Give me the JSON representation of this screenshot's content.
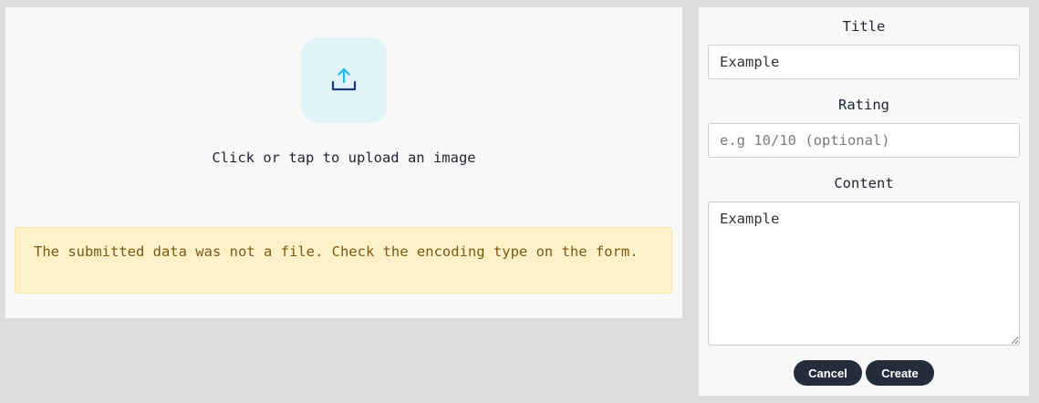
{
  "upload": {
    "icon": "upload-icon",
    "prompt": "Click or tap to upload an image"
  },
  "error": {
    "message": "The submitted data was not a file. Check the encoding type on the form."
  },
  "form": {
    "title_label": "Title",
    "title_value": "Example",
    "rating_label": "Rating",
    "rating_value": "",
    "rating_placeholder": "e.g 10/10 (optional)",
    "content_label": "Content",
    "content_value": "Example",
    "cancel_label": "Cancel",
    "create_label": "Create"
  },
  "colors": {
    "background": "#dcdcdc",
    "panel": "#f8f8f8",
    "icon_box": "#e1f4f9",
    "icon_arrow": "#22b8e6",
    "icon_tray": "#1f3a7a",
    "error_bg": "#fdf1c9",
    "error_text": "#7a5a14",
    "button_bg": "#252c3b"
  }
}
